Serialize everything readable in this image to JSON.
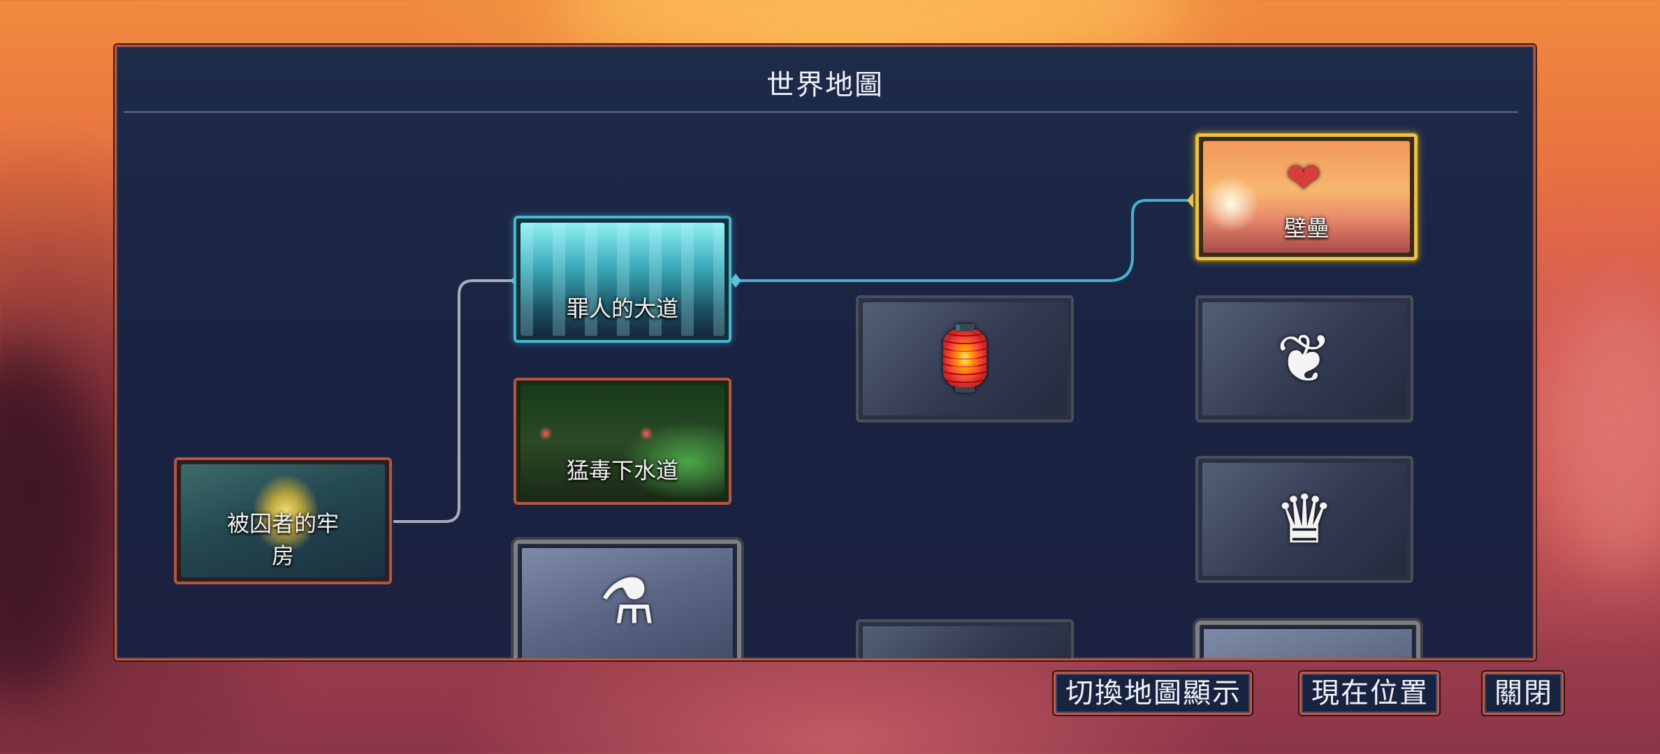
{
  "map": {
    "title": "世界地圖"
  },
  "nodes": {
    "prison": {
      "label": "被囚者的牢房",
      "label_line1": "被囚者的牢",
      "label_line2": "房"
    },
    "promenade": {
      "label": "罪人的大道"
    },
    "sewers": {
      "label": "猛毒下水道"
    },
    "ramparts": {
      "label": "壁壘"
    },
    "locked_cage": {
      "icon": "birdcage-icon"
    },
    "locked_flask": {
      "icon": "flask-icon"
    },
    "locked_vine": {
      "icon": "vine-rune-icon"
    },
    "locked_crown": {
      "icon": "spike-rune-icon"
    }
  },
  "buttons": {
    "toggle_view": "切換地圖顯示",
    "current_location": "現在位置",
    "close": "關閉"
  },
  "colors": {
    "active_path": "#3fb2d4",
    "inactive_path": "#a8adb8",
    "ramparts_border": "#e8c24a",
    "promenade_border": "#48b6cf",
    "button_border": "#c8583d"
  }
}
